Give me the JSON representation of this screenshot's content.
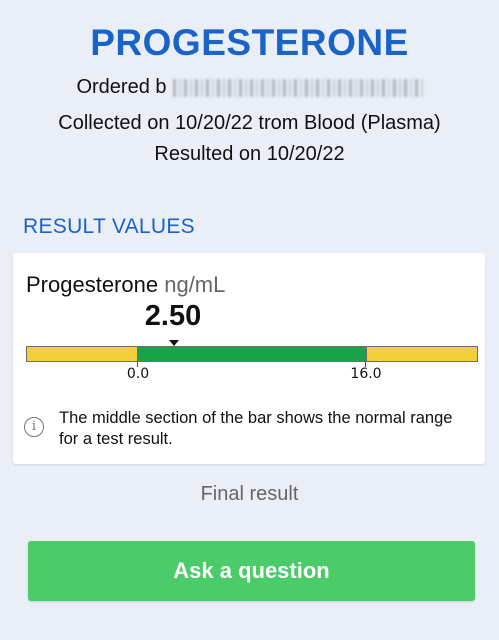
{
  "header": {
    "title": "PROGESTERONE",
    "ordered_prefix": "Ordered b",
    "collected": "Collected on 10/20/22 trom Blood (Plasma)",
    "resulted": "Resulted on 10/20/22"
  },
  "section": {
    "heading": "RESULT VALUES"
  },
  "result": {
    "name": "Progesterone",
    "unit": "ng/mL",
    "value": "2.50",
    "value_numeric": 2.5,
    "range_low": "0.0",
    "range_high": "16.0",
    "info_text": "The middle section of the bar shows the normal range for a test result.",
    "info_icon": "info-circle-icon",
    "colors": {
      "low": "#f2cf3b",
      "normal": "#1aa34a",
      "high": "#f2cf3b"
    }
  },
  "status": "Final result",
  "actions": {
    "ask_label": "Ask a question"
  },
  "colors": {
    "accent": "#1a63c7",
    "button": "#4ccb6a"
  }
}
